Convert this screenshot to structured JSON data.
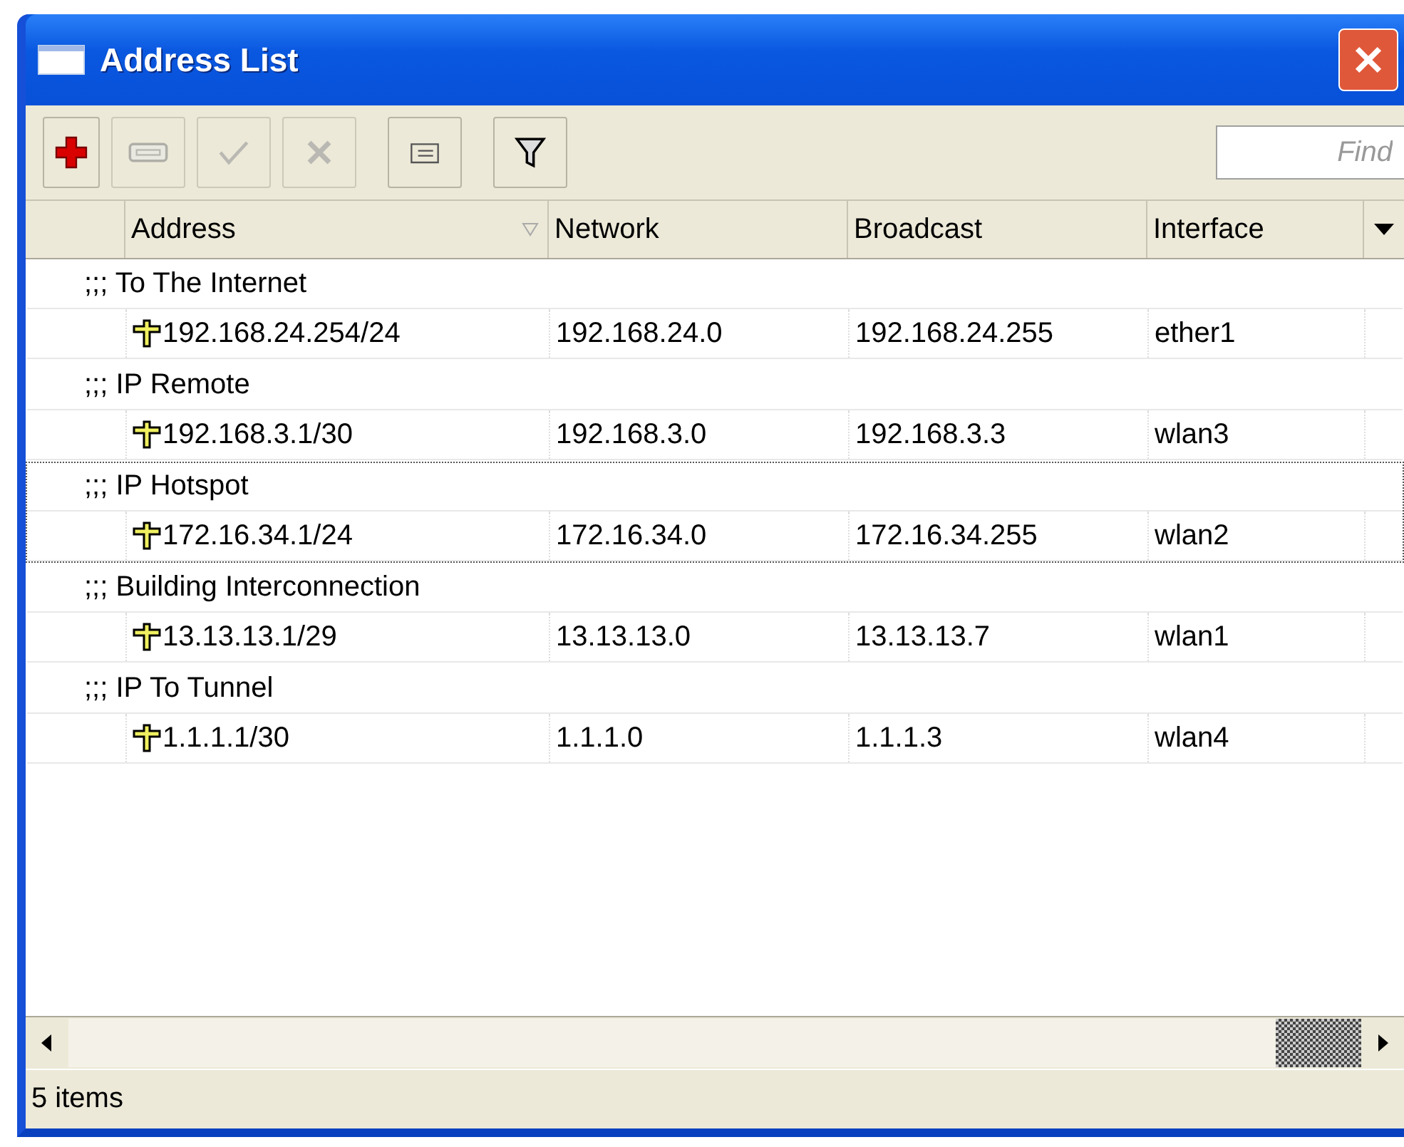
{
  "window": {
    "title": "Address List"
  },
  "toolbar": [
    {
      "kind": "add",
      "disabled": false
    },
    {
      "kind": "remove",
      "disabled": true
    },
    {
      "kind": "enable",
      "disabled": true
    },
    {
      "kind": "disable",
      "disabled": true
    },
    {
      "kind": "comment",
      "disabled": false
    },
    {
      "kind": "filter",
      "disabled": false
    }
  ],
  "search": {
    "placeholder": "Find"
  },
  "table": {
    "columns": [
      {
        "label": "Address",
        "sorted": true
      },
      {
        "label": "Network",
        "sorted": false
      },
      {
        "label": "Broadcast",
        "sorted": false
      },
      {
        "label": "Interface",
        "sorted": false
      }
    ],
    "rows": [
      {
        "comment": ";;; To The Internet",
        "cells": [
          "192.168.24.254/24",
          "192.168.24.0",
          "192.168.24.255",
          "ether1"
        ],
        "focused": false
      },
      {
        "comment": ";;; IP Remote",
        "cells": [
          "192.168.3.1/30",
          "192.168.3.0",
          "192.168.3.3",
          "wlan3"
        ],
        "focused": false
      },
      {
        "comment": ";;; IP Hotspot",
        "cells": [
          "172.16.34.1/24",
          "172.16.34.0",
          "172.16.34.255",
          "wlan2"
        ],
        "focused": true
      },
      {
        "comment": ";;; Building Interconnection",
        "cells": [
          "13.13.13.1/29",
          "13.13.13.0",
          "13.13.13.7",
          "wlan1"
        ],
        "focused": false
      },
      {
        "comment": ";;; IP To Tunnel",
        "cells": [
          "1.1.1.1/30",
          "1.1.1.0",
          "1.1.1.3",
          "wlan4"
        ],
        "focused": false
      }
    ]
  },
  "status_bar": "5 items"
}
